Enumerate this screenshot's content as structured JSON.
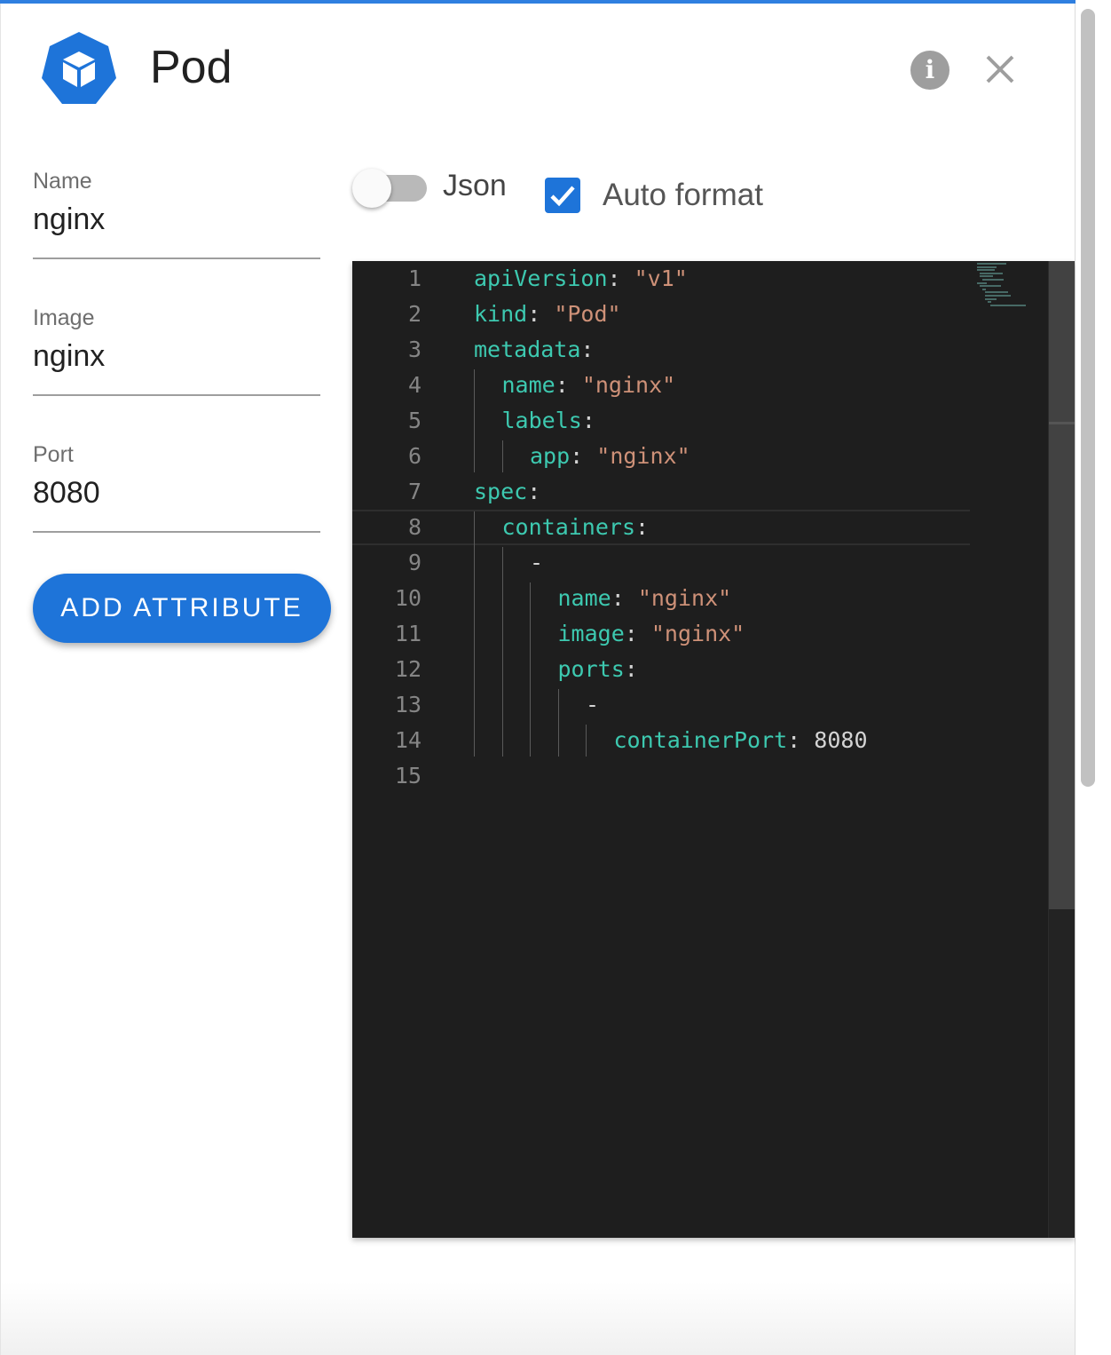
{
  "header": {
    "title": "Pod",
    "logo_icon": "kubernetes-cube-icon",
    "info_icon": "info-icon",
    "close_icon": "close-icon",
    "accent": "#1e74d9"
  },
  "form": {
    "fields": [
      {
        "label": "Name",
        "value": "nginx"
      },
      {
        "label": "Image",
        "value": "nginx"
      },
      {
        "label": "Port",
        "value": "8080"
      }
    ],
    "add_button": "ADD ATTRIBUTE"
  },
  "options": {
    "json_label": "Json",
    "json_on": false,
    "auto_format_label": "Auto format",
    "auto_format_checked": true
  },
  "editor": {
    "current_line": 8,
    "lines": [
      {
        "n": "1",
        "indent": 0,
        "key": "apiVersion",
        "value": "\"v1\"",
        "vtype": "s"
      },
      {
        "n": "2",
        "indent": 0,
        "key": "kind",
        "value": "\"Pod\"",
        "vtype": "s"
      },
      {
        "n": "3",
        "indent": 0,
        "key": "metadata",
        "value": "",
        "vtype": ""
      },
      {
        "n": "4",
        "indent": 1,
        "key": "name",
        "value": "\"nginx\"",
        "vtype": "s"
      },
      {
        "n": "5",
        "indent": 1,
        "key": "labels",
        "value": "",
        "vtype": ""
      },
      {
        "n": "6",
        "indent": 2,
        "key": "app",
        "value": "\"nginx\"",
        "vtype": "s"
      },
      {
        "n": "7",
        "indent": 0,
        "key": "spec",
        "value": "",
        "vtype": ""
      },
      {
        "n": "8",
        "indent": 1,
        "key": "containers",
        "value": "",
        "vtype": ""
      },
      {
        "n": "9",
        "indent": 2,
        "dash": "-"
      },
      {
        "n": "10",
        "indent": 3,
        "key": "name",
        "value": "\"nginx\"",
        "vtype": "s"
      },
      {
        "n": "11",
        "indent": 3,
        "key": "image",
        "value": "\"nginx\"",
        "vtype": "s"
      },
      {
        "n": "12",
        "indent": 3,
        "key": "ports",
        "value": "",
        "vtype": ""
      },
      {
        "n": "13",
        "indent": 4,
        "dash": "-"
      },
      {
        "n": "14",
        "indent": 5,
        "key": "containerPort",
        "value": "8080",
        "vtype": "n"
      },
      {
        "n": "15",
        "indent": 0,
        "key": "",
        "value": "",
        "vtype": ""
      }
    ]
  }
}
